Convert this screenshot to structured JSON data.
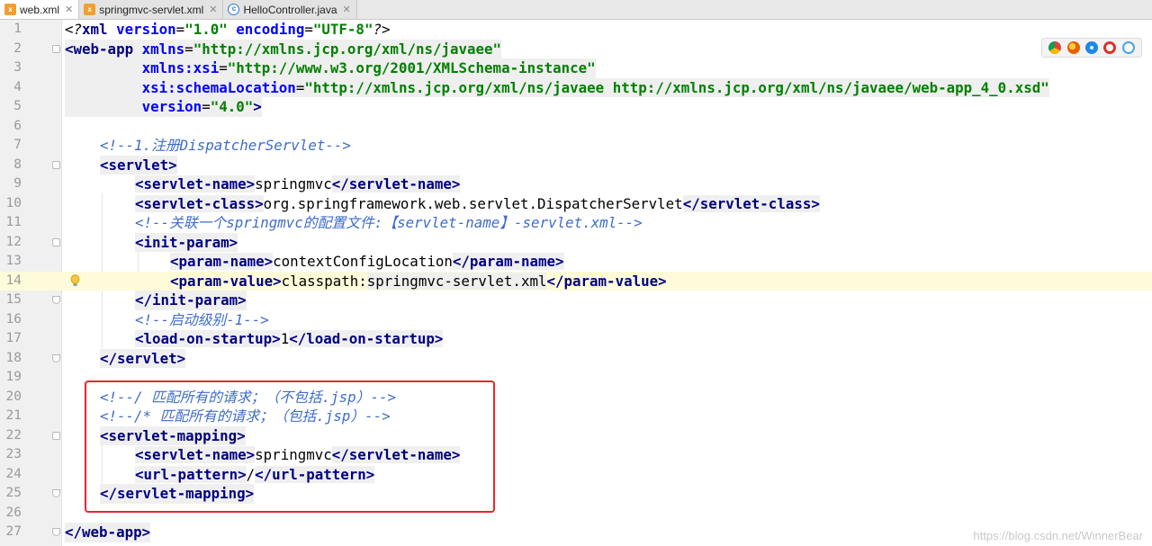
{
  "tabs": [
    {
      "label": "web.xml",
      "active": true,
      "icon": "xml-file-icon"
    },
    {
      "label": "springmvc-servlet.xml",
      "active": false,
      "icon": "xml-file-icon"
    },
    {
      "label": "HelloController.java",
      "active": false,
      "icon": "java-class-icon"
    }
  ],
  "current_line": 14,
  "lines": [
    {
      "n": "1"
    },
    {
      "n": "2"
    },
    {
      "n": "3"
    },
    {
      "n": "4"
    },
    {
      "n": "5"
    },
    {
      "n": "6"
    },
    {
      "n": "7"
    },
    {
      "n": "8"
    },
    {
      "n": "9"
    },
    {
      "n": "10"
    },
    {
      "n": "11"
    },
    {
      "n": "12"
    },
    {
      "n": "13"
    },
    {
      "n": "14"
    },
    {
      "n": "15"
    },
    {
      "n": "16"
    },
    {
      "n": "17"
    },
    {
      "n": "18"
    },
    {
      "n": "19"
    },
    {
      "n": "20"
    },
    {
      "n": "21"
    },
    {
      "n": "22"
    },
    {
      "n": "23"
    },
    {
      "n": "24"
    },
    {
      "n": "25"
    },
    {
      "n": "26"
    },
    {
      "n": "27"
    }
  ],
  "code": {
    "l1_a": "<?",
    "l1_b": "xml",
    "l1_c": " version",
    "l1_d": "=",
    "l1_e": "\"1.0\"",
    "l1_f": " encoding",
    "l1_g": "=",
    "l1_h": "\"UTF-8\"",
    "l1_i": "?>",
    "l2_a": "<web-app",
    "l2_b": " xmlns",
    "l2_c": "=",
    "l2_d": "\"http://xmlns.jcp.org/xml/ns/javaee\"",
    "l3_a": "xmlns:xsi",
    "l3_b": "=",
    "l3_c": "\"http://www.w3.org/2001/XMLSchema-instance\"",
    "l4_a": "xsi:schemaLocation",
    "l4_b": "=",
    "l4_c": "\"http://xmlns.jcp.org/xml/ns/javaee http://xmlns.jcp.org/xml/ns/javaee/web-app_4_0.xsd\"",
    "l5_a": "version",
    "l5_b": "=",
    "l5_c": "\"4.0\"",
    "l5_d": ">",
    "l7": "<!--1.注册DispatcherServlet-->",
    "l8": "<servlet>",
    "l9_a": "<servlet-name>",
    "l9_b": "springmvc",
    "l9_c": "</servlet-name>",
    "l10_a": "<servlet-class>",
    "l10_b": "org.springframework.web.servlet.DispatcherServlet",
    "l10_c": "</servlet-class>",
    "l11": "<!--关联一个springmvc的配置文件:【servlet-name】-servlet.xml-->",
    "l12": "<init-param>",
    "l13_a": "<param-name>",
    "l13_b": "contextConfigLocation",
    "l13_c": "</param-name>",
    "l14_a": "<param-value>",
    "l14_b": "classpath:",
    "l14_c": "springmvc-servlet.xml",
    "l14_d": "</param-value>",
    "l15": "</init-param>",
    "l16": "<!--启动级别-1-->",
    "l17_a": "<load-on-startup>",
    "l17_b": "1",
    "l17_c": "</load-on-startup>",
    "l18": "</servlet>",
    "l20": "<!--/ 匹配所有的请求；（不包括.jsp）-->",
    "l21": "<!--/* 匹配所有的请求；（包括.jsp）-->",
    "l22": "<servlet-mapping>",
    "l23_a": "<servlet-name>",
    "l23_b": "springmvc",
    "l23_c": "</servlet-name>",
    "l24_a": "<url-pattern>",
    "l24_b": "/",
    "l24_c": "</url-pattern>",
    "l25": "</servlet-mapping>",
    "l27": "</web-app>"
  },
  "browsers": [
    "chrome-icon",
    "firefox-icon",
    "safari-icon",
    "opera-icon",
    "ie-icon"
  ],
  "watermark": "https://blog.csdn.net/WinnerBear",
  "colors": {
    "highlight_box": "#e8262a",
    "tag": "#000080",
    "attr": "#0000ff",
    "value": "#008000",
    "comment": "#808080"
  }
}
